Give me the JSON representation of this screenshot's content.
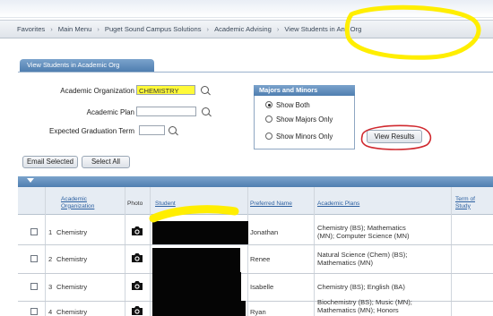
{
  "breadcrumb": [
    "Favorites",
    "Main Menu",
    "Puget Sound Campus Solutions",
    "Academic Advising",
    "View Students in Any Org"
  ],
  "breadcrumb_separator": "›",
  "tab": {
    "label": "View Students in Academic Org"
  },
  "form": {
    "org_label": "Academic Organization",
    "org_value": "CHEMISTRY",
    "plan_label": "Academic Plan",
    "plan_value": "",
    "term_label": "Expected Graduation Term",
    "term_value": ""
  },
  "majors_box": {
    "title": "Majors and Minors",
    "options": [
      "Show Both",
      "Show Majors Only",
      "Show Minors Only"
    ],
    "selected": "Show Both"
  },
  "buttons": {
    "view_results": "View Results",
    "email_selected": "Email Selected",
    "select_all": "Select All"
  },
  "grid": {
    "columns": [
      "Academic Organization",
      "Photo",
      "Student",
      "Preferred Name",
      "Academic Plans",
      "Term of Study"
    ],
    "rows": [
      {
        "num": "1",
        "org": "Chemistry",
        "preferred": "Jonathan",
        "plans": [
          "Chemistry (BS); Mathematics",
          "(MN); Computer Science (MN)"
        ]
      },
      {
        "num": "2",
        "org": "Chemistry",
        "preferred": "Renee",
        "plans": [
          "Natural Science (Chem) (BS);",
          "Mathematics (MN)"
        ]
      },
      {
        "num": "3",
        "org": "Chemistry",
        "preferred": "Isabelle",
        "plans": [
          "Chemistry (BS); English (BA)"
        ]
      },
      {
        "num": "4",
        "org": "Chemistry",
        "preferred": "Ryan",
        "plans": [
          "Biochemistry (BS); Music (MN);",
          "Mathematics (MN); Honors"
        ]
      }
    ]
  },
  "colors": {
    "header_blue": "#5a88b8",
    "highlight": "#ffee00",
    "circle": "#d0282e"
  },
  "icons": {
    "lookup": "magnifier-icon",
    "photo": "camera-icon",
    "grid_toggle": "collapse-arrow-icon"
  }
}
